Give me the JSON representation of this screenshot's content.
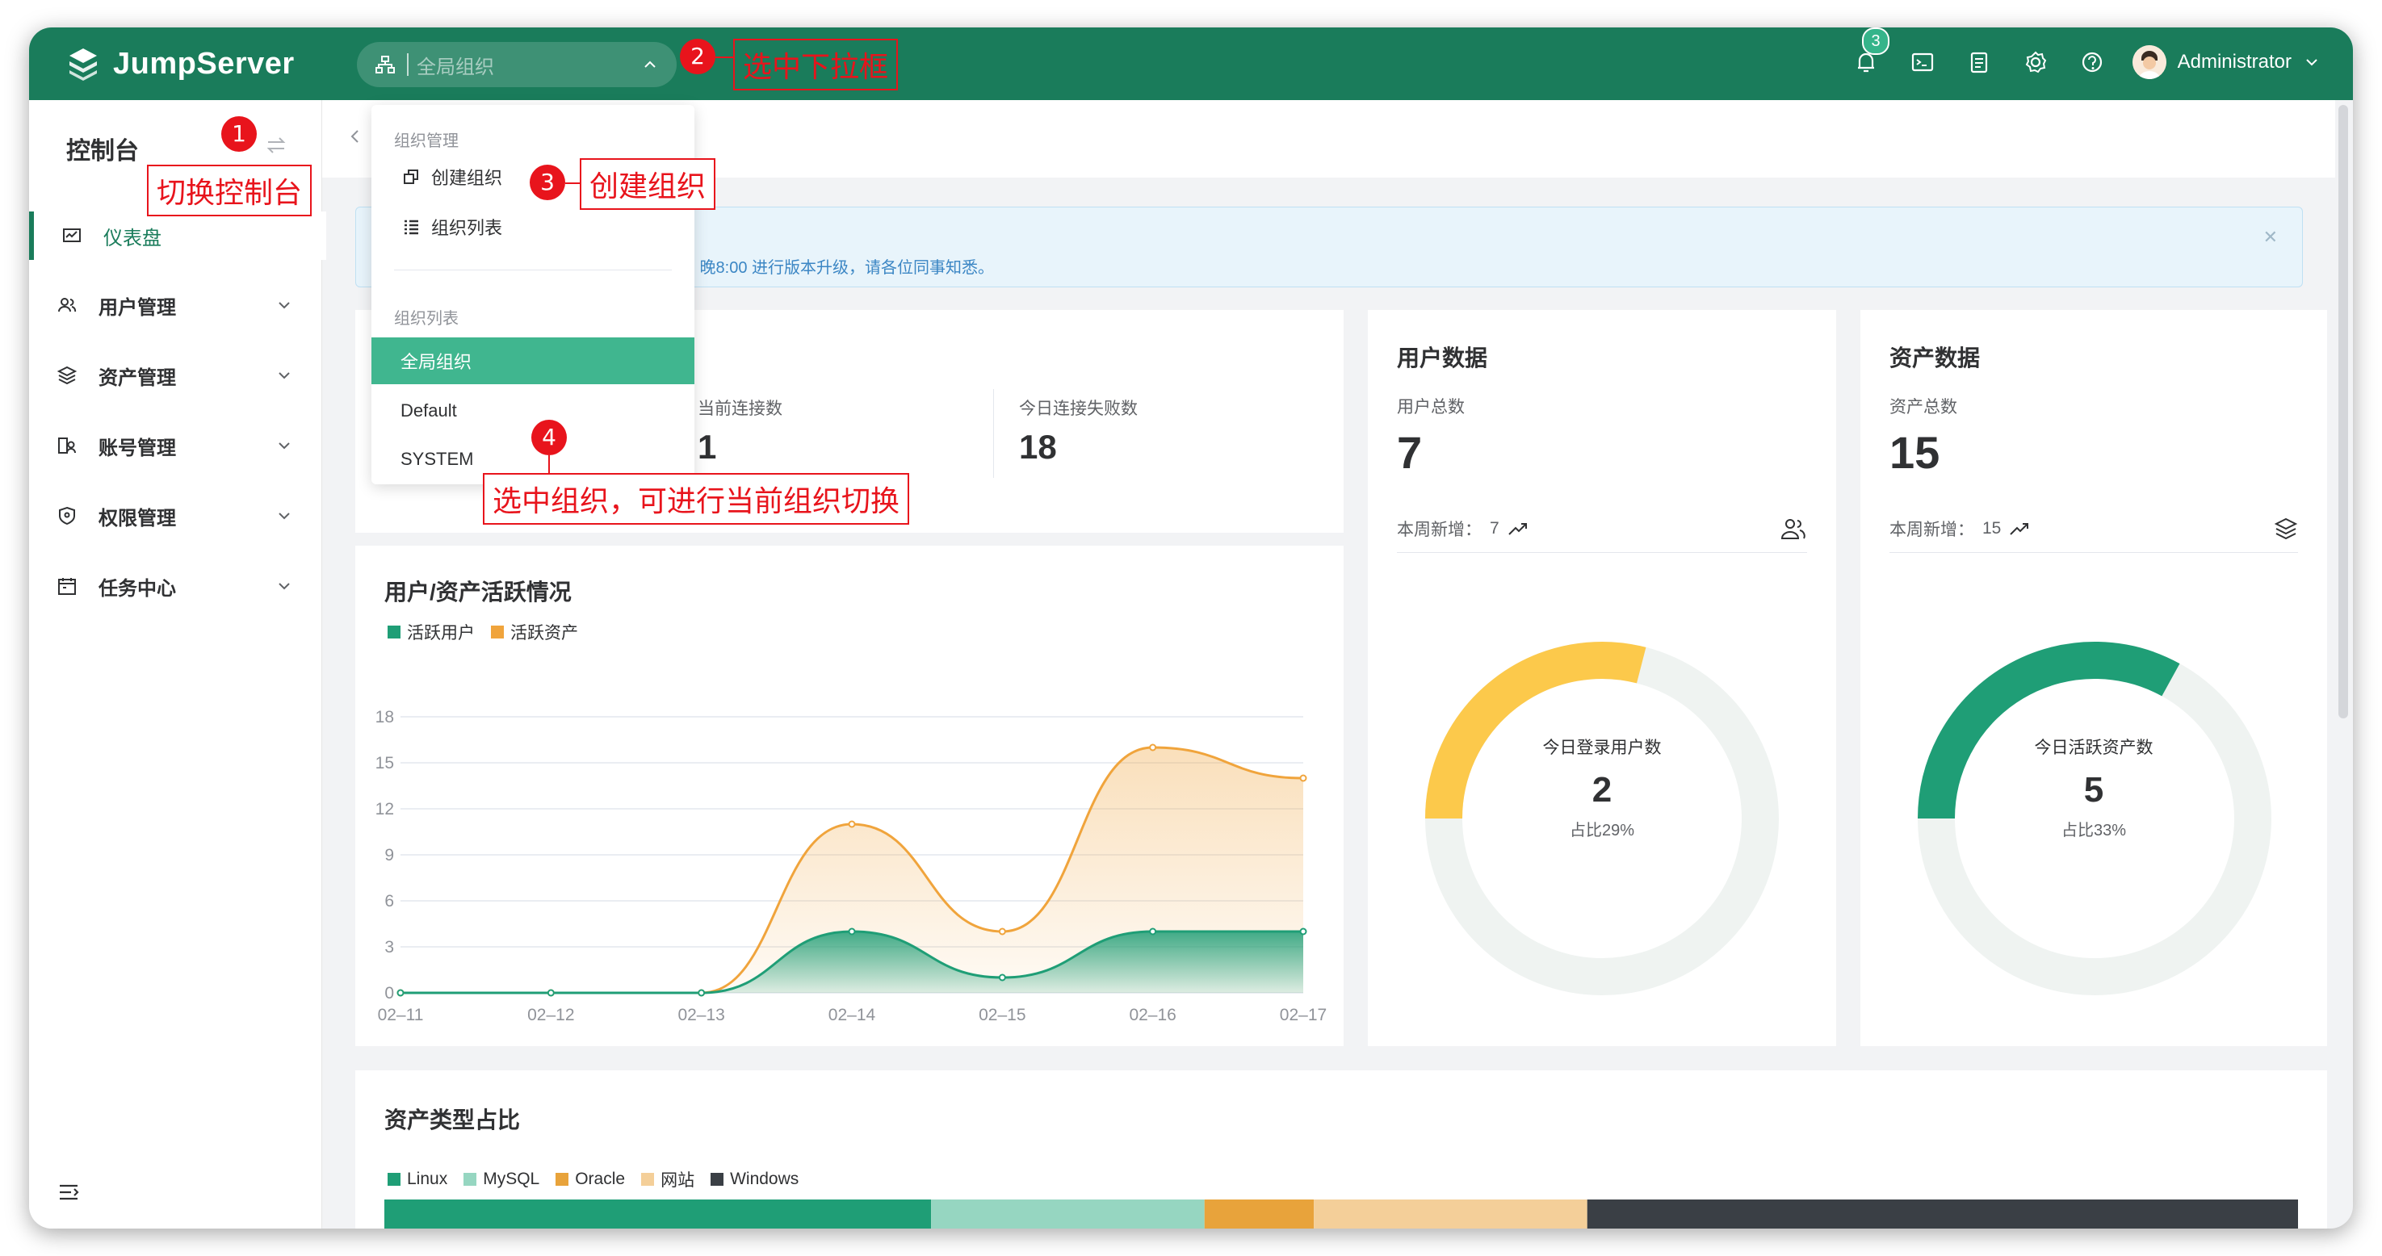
{
  "header": {
    "brand": "JumpServer",
    "org_select": {
      "placeholder": "全局组织"
    },
    "notification_count": "3",
    "user": "Administrator"
  },
  "sidebar": {
    "title": "控制台",
    "items": [
      {
        "label": "仪表盘",
        "icon": "dashboard-icon",
        "active": true
      },
      {
        "label": "用户管理",
        "icon": "users-icon"
      },
      {
        "label": "资产管理",
        "icon": "layers-icon"
      },
      {
        "label": "账号管理",
        "icon": "account-icon"
      },
      {
        "label": "权限管理",
        "icon": "shield-icon"
      },
      {
        "label": "任务中心",
        "icon": "calendar-icon"
      }
    ]
  },
  "alert": {
    "text": "日 晚8:00 进行版本升级，请各位同事知悉。"
  },
  "session_card": {
    "current_label": "当前连接数",
    "current_value": "1",
    "failed_label": "今日连接失败数",
    "failed_value": "18"
  },
  "user_card": {
    "title": "用户数据",
    "total_label": "用户总数",
    "total_value": "7",
    "week_label": "本周新增：",
    "week_value": "7",
    "donut": {
      "label": "今日登录用户数",
      "value": "2",
      "percent_text": "占比29%",
      "fraction": 0.29
    }
  },
  "asset_card": {
    "title": "资产数据",
    "total_label": "资产总数",
    "total_value": "15",
    "week_label": "本周新增：",
    "week_value": "15",
    "donut": {
      "label": "今日活跃资产数",
      "value": "5",
      "percent_text": "占比33%",
      "fraction": 0.33
    }
  },
  "dropdown": {
    "group1": "组织管理",
    "create": "创建组织",
    "list": "组织列表",
    "group2": "组织列表",
    "orgs": [
      "全局组织",
      "Default",
      "SYSTEM"
    ]
  },
  "annotations": {
    "n1": "1",
    "t1": "切换控制台",
    "n2": "2",
    "t2": "选中下拉框",
    "n3": "3",
    "t3": "创建组织",
    "n4": "4",
    "t4": "选中组织，可进行当前组织切换"
  },
  "colors": {
    "primary": "#1a7c5b",
    "accent": "#40b68f",
    "orange": "#f0a43c",
    "red": "#e8141c"
  },
  "chart_data": [
    {
      "type": "area",
      "title": "用户/资产活跃情况",
      "x": [
        "02–11",
        "02–12",
        "02–13",
        "02–14",
        "02–15",
        "02–16",
        "02–17"
      ],
      "ylim": [
        0,
        18
      ],
      "yticks": [
        0,
        3,
        6,
        9,
        12,
        15,
        18
      ],
      "grid": true,
      "legend": "top-left",
      "series": [
        {
          "name": "活跃用户",
          "color": "#1f9e76",
          "values": [
            0,
            0,
            0,
            4,
            1,
            4,
            4
          ]
        },
        {
          "name": "活跃资产",
          "color": "#f0a43c",
          "values": [
            0,
            0,
            0,
            11,
            4,
            16,
            14
          ]
        }
      ]
    },
    {
      "type": "bar",
      "title": "资产类型占比",
      "stacked": true,
      "orientation": "horizontal",
      "legend": "top-left",
      "series": [
        {
          "name": "Linux",
          "color": "#1f9e76",
          "value": 6
        },
        {
          "name": "MySQL",
          "color": "#96d6c1",
          "value": 3
        },
        {
          "name": "Oracle",
          "color": "#e8a33b",
          "value": 1.2
        },
        {
          "name": "网站",
          "color": "#f4cf99",
          "value": 3
        },
        {
          "name": "Windows",
          "color": "#3a3f45",
          "value": 7.8
        }
      ]
    }
  ]
}
